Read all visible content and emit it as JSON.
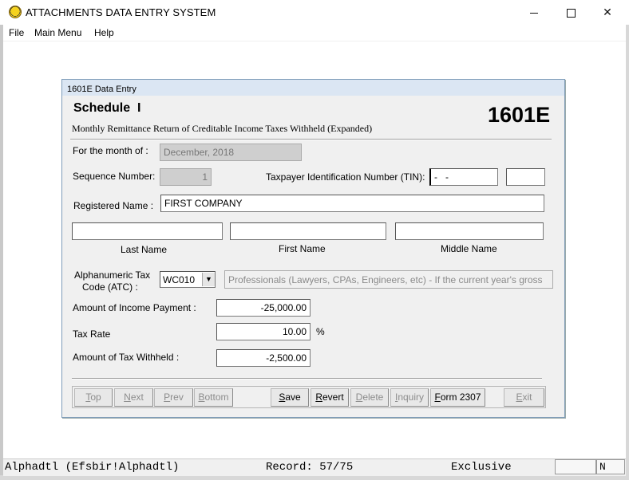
{
  "window": {
    "title": "ATTACHMENTS DATA ENTRY SYSTEM",
    "icon": "app-icon"
  },
  "menu": {
    "items": [
      "File",
      "Main Menu",
      "Help"
    ]
  },
  "dialog": {
    "title": "1601E Data Entry",
    "schedule_label": "Schedule  I",
    "form_code": "1601E",
    "description": "Monthly Remittance Return of Creditable Income Taxes Withheld (Expanded)"
  },
  "fields": {
    "month": {
      "label": "For the month of :",
      "value": "December, 2018"
    },
    "sequence": {
      "label": "Sequence Number:",
      "value": "1"
    },
    "tin": {
      "label": "Taxpayer Identification Number (TIN):",
      "value": "-   -",
      "branch": ""
    },
    "registered_name": {
      "label": "Registered Name :",
      "value": "FIRST COMPANY"
    },
    "last_name": {
      "label": "Last Name",
      "value": ""
    },
    "first_name": {
      "label": "First Name",
      "value": ""
    },
    "middle_name": {
      "label": "Middle Name",
      "value": ""
    },
    "atc": {
      "label_line1": "Alphanumeric Tax",
      "label_line2": "Code (ATC) :",
      "value": "WC010",
      "description": "Professionals (Lawyers, CPAs, Engineers, etc) -  If the current year's gross"
    },
    "income_payment": {
      "label": "Amount of Income Payment :",
      "value": "-25,000.00"
    },
    "tax_rate": {
      "label": "Tax Rate",
      "value": "10.00",
      "unit": "%"
    },
    "tax_withheld": {
      "label": "Amount of Tax Withheld :",
      "value": "-2,500.00"
    }
  },
  "buttons": {
    "top": {
      "hot": "T",
      "rest": "op"
    },
    "next": {
      "hot": "N",
      "rest": "ext"
    },
    "prev": {
      "hot": "P",
      "rest": "rev"
    },
    "bottom": {
      "hot": "B",
      "rest": "ottom"
    },
    "save": {
      "hot": "S",
      "rest": "ave"
    },
    "revert": {
      "hot": "R",
      "rest": "evert"
    },
    "delete": {
      "hot": "D",
      "rest": "elete"
    },
    "inquiry": {
      "hot": "I",
      "rest": "nquiry"
    },
    "form2307": {
      "hot": "F",
      "rest": "orm 2307"
    },
    "exit": {
      "hot": "E",
      "rest": "xit"
    }
  },
  "status": {
    "alias": "Alphadtl (Efsbir!Alphadtl)",
    "record": "Record: 57/75",
    "mode": "Exclusive",
    "box1": "",
    "box2": "N"
  }
}
